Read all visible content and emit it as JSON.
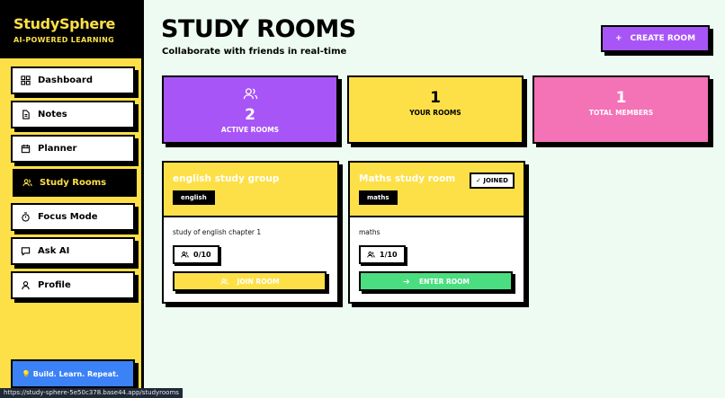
{
  "brand": {
    "title": "StudySphere",
    "subtitle": "AI-POWERED LEARNING"
  },
  "sidebar": {
    "items": [
      {
        "label": "Dashboard",
        "icon": "grid-icon"
      },
      {
        "label": "Notes",
        "icon": "document-icon"
      },
      {
        "label": "Planner",
        "icon": "calendar-icon"
      },
      {
        "label": "Study Rooms",
        "icon": "users-icon",
        "active": true
      },
      {
        "label": "Focus Mode",
        "icon": "timer-icon"
      },
      {
        "label": "Ask AI",
        "icon": "chat-icon"
      },
      {
        "label": "Profile",
        "icon": "user-icon"
      }
    ],
    "tip": "💡 Build. Learn. Repeat."
  },
  "header": {
    "title": "STUDY ROOMS",
    "subtitle": "Collaborate with friends in real-time",
    "create_label": "CREATE ROOM",
    "create_icon": "plus-icon"
  },
  "stats": [
    {
      "value": "2",
      "label": "ACTIVE ROOMS",
      "color": "#a855f7",
      "icon": "users-icon"
    },
    {
      "value": "1",
      "label": "YOUR ROOMS",
      "color": "#fde047"
    },
    {
      "value": "1",
      "label": "TOTAL MEMBERS",
      "color": "#f472b6"
    }
  ],
  "rooms": [
    {
      "name": "english study group",
      "tag": "english",
      "description": "study of english chapter 1",
      "members": "0/10",
      "action": "JOIN ROOM",
      "action_color": "#fde047",
      "joined": false
    },
    {
      "name": "Maths study room",
      "tag": "maths",
      "description": "maths",
      "members": "1/10",
      "action": "ENTER ROOM",
      "action_color": "#4ade80",
      "joined": true,
      "joined_label": "✓ JOINED"
    }
  ],
  "status_url": "https://study-sphere-5e50c378.base44.app/studyrooms",
  "colors": {
    "accent": "#fde047",
    "background": "#eefbf2",
    "purple": "#a855f7",
    "pink": "#f472b6",
    "green": "#4ade80",
    "blue": "#3b82f6"
  }
}
